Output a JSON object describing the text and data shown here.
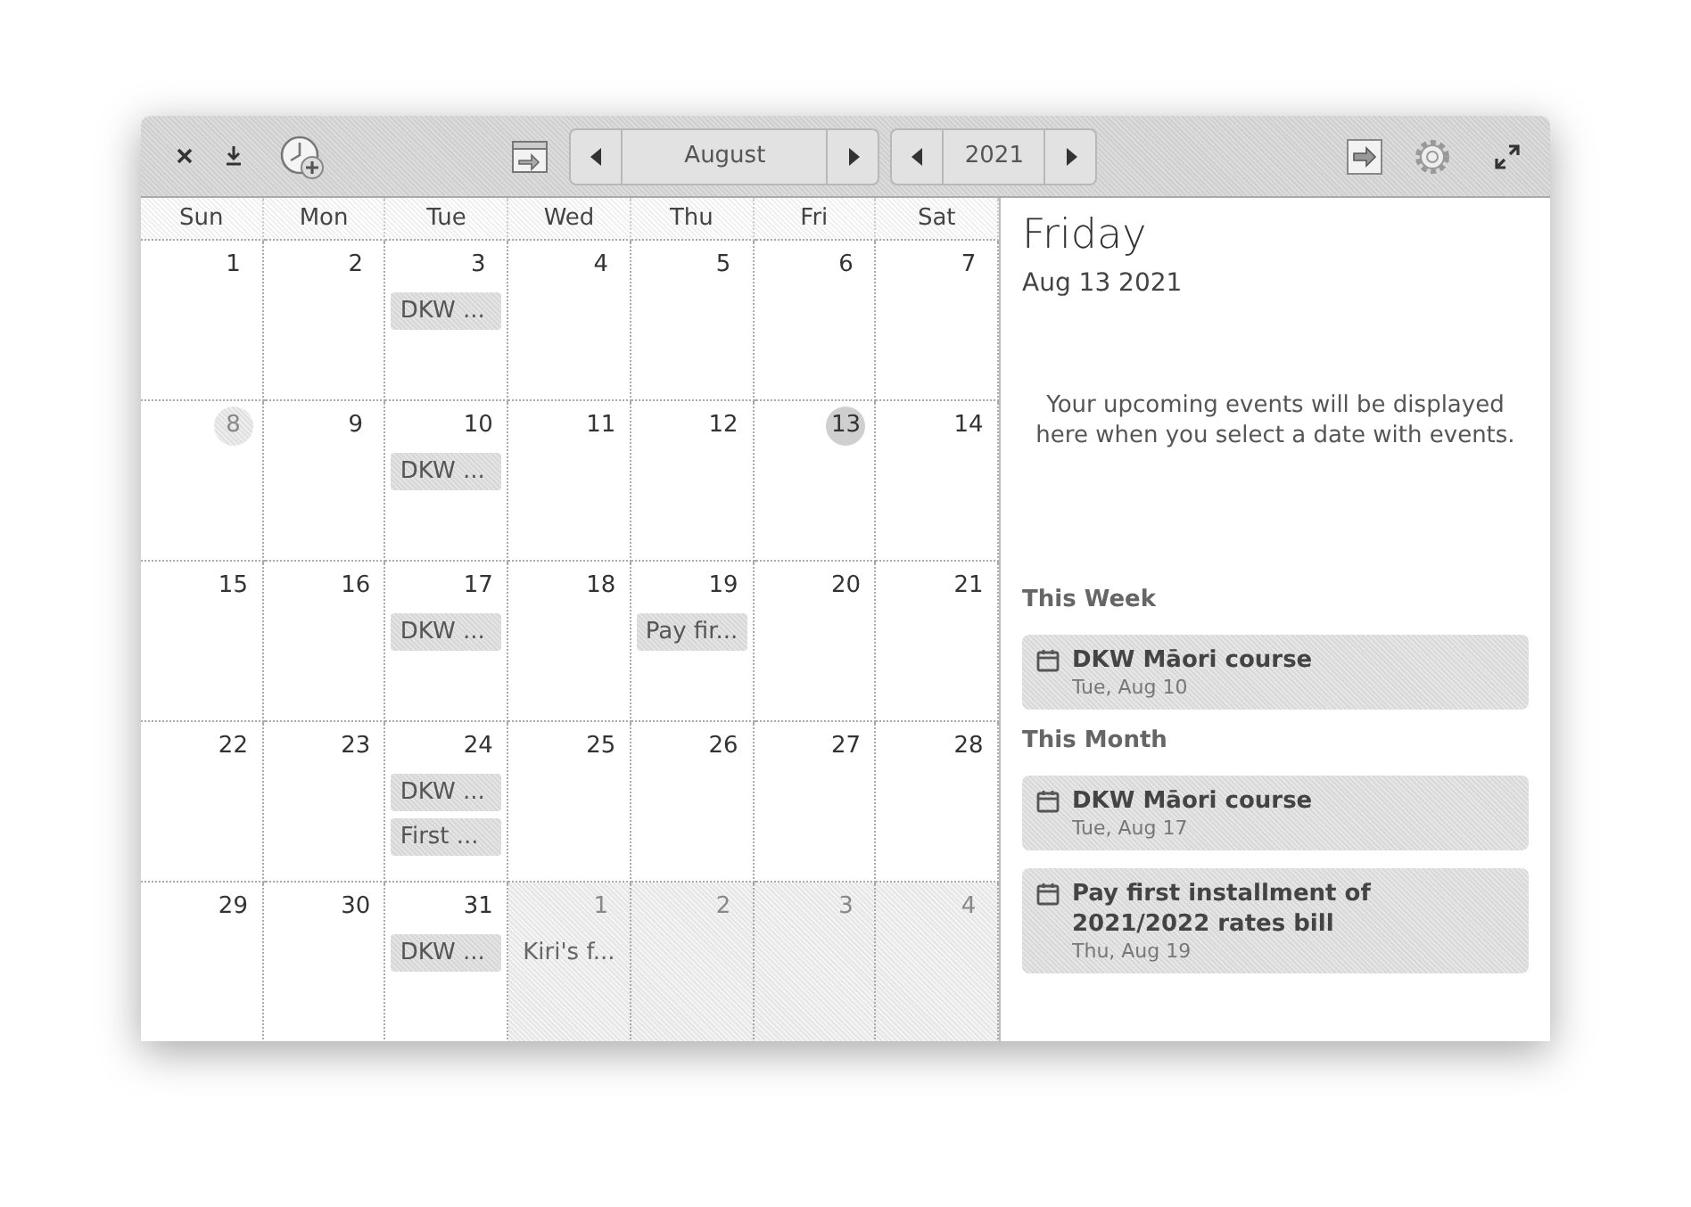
{
  "toolbar": {
    "month": "August",
    "year": "2021"
  },
  "weekdays": [
    "Sun",
    "Mon",
    "Tue",
    "Wed",
    "Thu",
    "Fri",
    "Sat"
  ],
  "weeks": [
    [
      {
        "day": "1",
        "other_month": false,
        "today": false,
        "selected": false
      },
      {
        "day": "2",
        "other_month": false,
        "today": false,
        "selected": false
      },
      {
        "day": "3",
        "events": [
          "DKW ..."
        ],
        "other_month": false,
        "today": false,
        "selected": false
      },
      {
        "day": "4",
        "other_month": false,
        "today": false,
        "selected": false
      },
      {
        "day": "5",
        "other_month": false,
        "today": false,
        "selected": false
      },
      {
        "day": "6",
        "other_month": false,
        "today": false,
        "selected": false
      },
      {
        "day": "7",
        "other_month": false,
        "today": false,
        "selected": false
      }
    ],
    [
      {
        "day": "8",
        "other_month": false,
        "today": true,
        "selected": false
      },
      {
        "day": "9",
        "other_month": false,
        "today": false,
        "selected": false
      },
      {
        "day": "10",
        "events": [
          "DKW ..."
        ],
        "other_month": false,
        "today": false,
        "selected": false
      },
      {
        "day": "11",
        "other_month": false,
        "today": false,
        "selected": false
      },
      {
        "day": "12",
        "other_month": false,
        "today": false,
        "selected": false
      },
      {
        "day": "13",
        "other_month": false,
        "today": false,
        "selected": true
      },
      {
        "day": "14",
        "other_month": false,
        "today": false,
        "selected": false
      }
    ],
    [
      {
        "day": "15",
        "other_month": false,
        "today": false,
        "selected": false
      },
      {
        "day": "16",
        "other_month": false,
        "today": false,
        "selected": false
      },
      {
        "day": "17",
        "events": [
          "DKW ..."
        ],
        "other_month": false,
        "today": false,
        "selected": false
      },
      {
        "day": "18",
        "other_month": false,
        "today": false,
        "selected": false
      },
      {
        "day": "19",
        "events": [
          "Pay fir..."
        ],
        "other_month": false,
        "today": false,
        "selected": false
      },
      {
        "day": "20",
        "other_month": false,
        "today": false,
        "selected": false
      },
      {
        "day": "21",
        "other_month": false,
        "today": false,
        "selected": false
      }
    ],
    [
      {
        "day": "22",
        "other_month": false,
        "today": false,
        "selected": false
      },
      {
        "day": "23",
        "other_month": false,
        "today": false,
        "selected": false
      },
      {
        "day": "24",
        "events": [
          "DKW ...",
          "First ..."
        ],
        "other_month": false,
        "today": false,
        "selected": false
      },
      {
        "day": "25",
        "other_month": false,
        "today": false,
        "selected": false
      },
      {
        "day": "26",
        "other_month": false,
        "today": false,
        "selected": false
      },
      {
        "day": "27",
        "other_month": false,
        "today": false,
        "selected": false
      },
      {
        "day": "28",
        "other_month": false,
        "today": false,
        "selected": false
      }
    ],
    [
      {
        "day": "29",
        "other_month": false,
        "today": false,
        "selected": false
      },
      {
        "day": "30",
        "other_month": false,
        "today": false,
        "selected": false
      },
      {
        "day": "31",
        "events": [
          "DKW ..."
        ],
        "other_month": false,
        "today": false,
        "selected": false
      },
      {
        "day": "1",
        "events": [
          "Kiri's f..."
        ],
        "other_month": true,
        "today": false,
        "selected": false
      },
      {
        "day": "2",
        "other_month": true,
        "today": false,
        "selected": false
      },
      {
        "day": "3",
        "other_month": true,
        "today": false,
        "selected": false
      },
      {
        "day": "4",
        "other_month": true,
        "today": false,
        "selected": false
      }
    ]
  ],
  "sidebar": {
    "weekday": "Friday",
    "date": "Aug 13 2021",
    "message": "Your upcoming events will be displayed here when you select a date with events.",
    "sections": [
      {
        "title": "This Week",
        "events": [
          {
            "title": "DKW Māori course",
            "date": "Tue, Aug 10"
          }
        ]
      },
      {
        "title": "This Month",
        "events": [
          {
            "title": "DKW Māori course",
            "date": "Tue, Aug 17"
          },
          {
            "title": "Pay first installment of 2021/2022 rates bill",
            "date": "Thu, Aug 19"
          }
        ]
      }
    ]
  }
}
